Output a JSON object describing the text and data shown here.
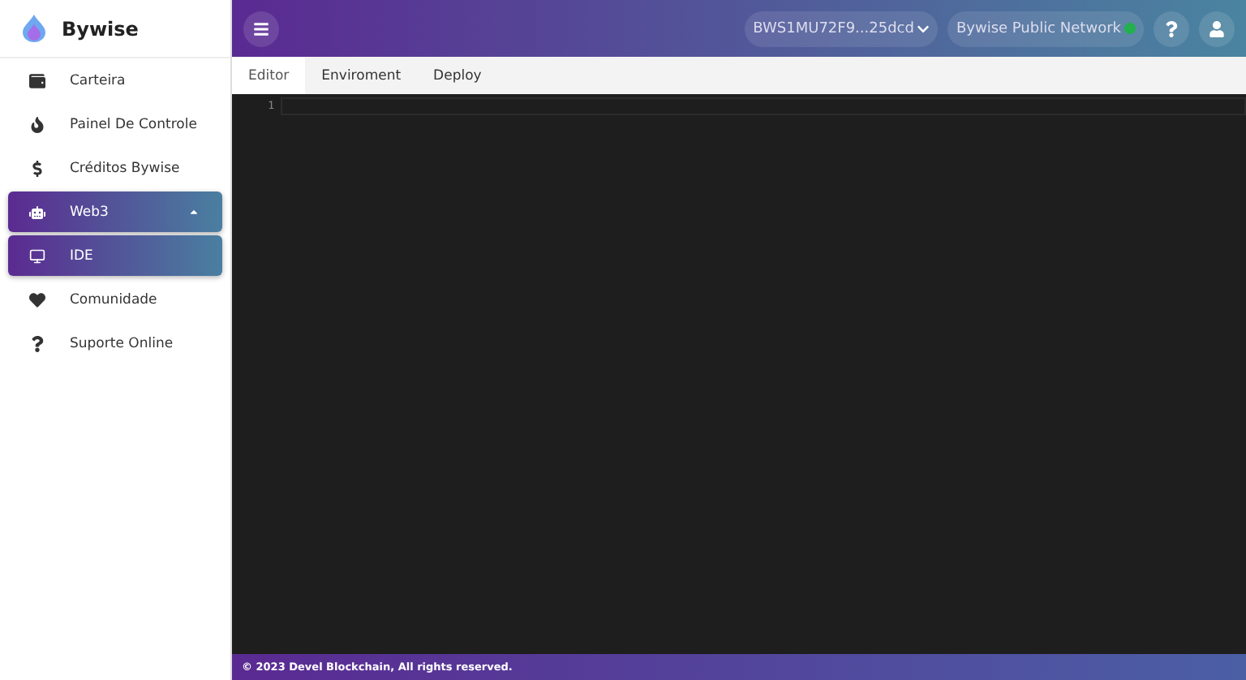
{
  "brand": "Bywise",
  "sidebar": {
    "items": [
      {
        "label": "Carteira",
        "selected": false
      },
      {
        "label": "Painel De Controle",
        "selected": false
      },
      {
        "label": "Créditos Bywise",
        "selected": false
      },
      {
        "label": "Web3",
        "selected": true,
        "expanded": true,
        "children": [
          {
            "label": "IDE",
            "selected": true
          }
        ]
      },
      {
        "label": "Comunidade",
        "selected": false
      },
      {
        "label": "Suporte Online",
        "selected": false
      }
    ]
  },
  "header": {
    "wallet": "BWS1MU72F9...25dcd",
    "network": {
      "label": "Bywise Public Network",
      "online": true
    }
  },
  "tabs": [
    {
      "label": "Editor",
      "selected": true
    },
    {
      "label": "Enviroment",
      "selected": false
    },
    {
      "label": "Deploy",
      "selected": false
    }
  ],
  "editor": {
    "line_numbers": [
      "1"
    ]
  },
  "footer": "© 2023 Devel Blockchain, All rights reserved."
}
